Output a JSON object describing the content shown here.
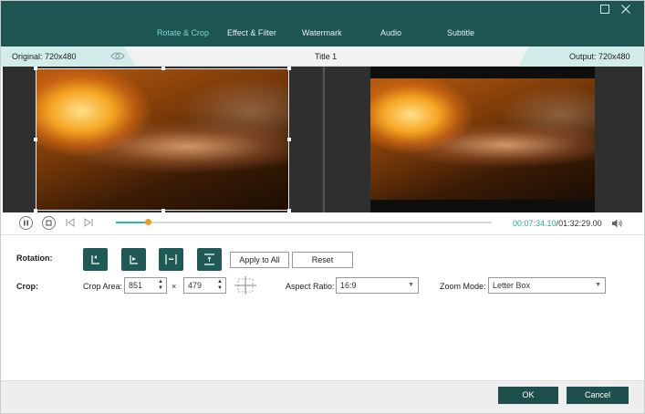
{
  "tabs": [
    {
      "label": "Rotate & Crop",
      "active": true
    },
    {
      "label": "Effect & Filter",
      "active": false
    },
    {
      "label": "Watermark",
      "active": false
    },
    {
      "label": "Audio",
      "active": false
    },
    {
      "label": "Subtitle",
      "active": false
    }
  ],
  "window_controls": {
    "maximize_icon": "maximize-icon",
    "close_icon": "close-icon"
  },
  "info": {
    "original": "Original: 720x480",
    "title": "Title 1",
    "output": "Output: 720x480"
  },
  "playback": {
    "current_time": "00:07:34.10",
    "separator": "/",
    "total_time": "01:32:29.00",
    "progress": 0.085
  },
  "rotation": {
    "label": "Rotation:",
    "apply_all": "Apply to All",
    "reset": "Reset"
  },
  "crop": {
    "label": "Crop:",
    "area_label": "Crop Area:",
    "width": "851",
    "times": "×",
    "height": "479",
    "aspect_label": "Aspect Ratio:",
    "aspect_value": "16:9",
    "zoom_label": "Zoom Mode:",
    "zoom_value": "Letter Box"
  },
  "footer": {
    "ok": "OK",
    "cancel": "Cancel"
  },
  "colors": {
    "header": "#1d5553",
    "accent": "#2fb7a9",
    "active_tab": "#7fd6cd",
    "knob": "#f39a1e"
  }
}
